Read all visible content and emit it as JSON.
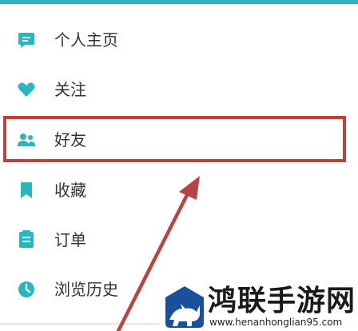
{
  "menu": {
    "items": [
      {
        "label": "个人主页",
        "icon": "profile-icon"
      },
      {
        "label": "关注",
        "icon": "heart-icon"
      },
      {
        "label": "好友",
        "icon": "friends-icon"
      },
      {
        "label": "收藏",
        "icon": "bookmark-icon"
      },
      {
        "label": "订单",
        "icon": "order-icon"
      },
      {
        "label": "浏览历史",
        "icon": "clock-icon"
      }
    ]
  },
  "watermark": {
    "title": "鸿联手游网",
    "url": "www.henanhonglian95.com"
  },
  "colors": {
    "accent": "#2bb5be",
    "highlight": "#b84442",
    "text": "#333333"
  }
}
